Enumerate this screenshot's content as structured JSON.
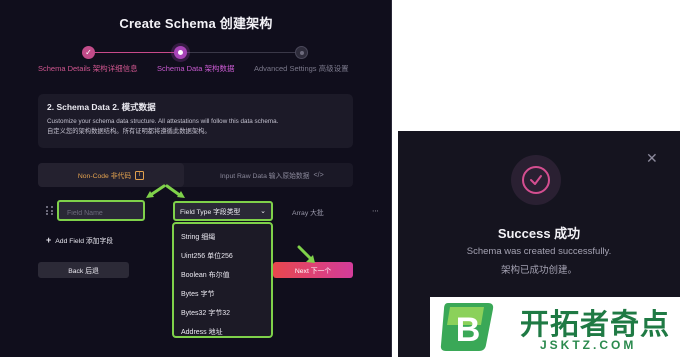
{
  "create_modal": {
    "title": "Create Schema 创建架构",
    "steps": [
      {
        "label": "Schema Details 架构详细信息",
        "state": "completed"
      },
      {
        "label": "Schema Data 架构数据",
        "state": "active"
      },
      {
        "label": "Advanced Settings 高级设置",
        "state": "pending"
      }
    ],
    "info": {
      "heading": "2. Schema Data 2. 模式数据",
      "line1": "Customize your schema data structure. All attestations will follow this data schema.",
      "line2": "自定义您的架构数据结构。所有证明都将遵循此数据架构。"
    },
    "mode_tabs": {
      "non_code": "Non-Code 非代码",
      "raw_data": "Input Raw Data 输入原始数据"
    },
    "field_row": {
      "field_name_placeholder": "Field Name",
      "field_type_label": "Field Type 字段类型",
      "array_label": "Array 大批"
    },
    "type_options": [
      "String 细绳",
      "Uint256 单位256",
      "Boolean 布尔值",
      "Bytes 字节",
      "Bytes32 字节32",
      "Address 地址"
    ],
    "add_field_label": "Add Field 添加字段",
    "back_label": "Back 后退",
    "next_label": "Next 下一个"
  },
  "success_modal": {
    "title": "Success 成功",
    "line1": "Schema was created successfully.",
    "line2": "架构已成功创建。"
  },
  "watermark": {
    "text": "开拓者奇点",
    "sub": "JSKTZ.COM",
    "logo_letter": "B"
  },
  "colors": {
    "accent_pink": "#d44e90",
    "highlight_green": "#7fd14a",
    "code_orange": "#e3a24f",
    "panel_bg": "#100e1c"
  }
}
